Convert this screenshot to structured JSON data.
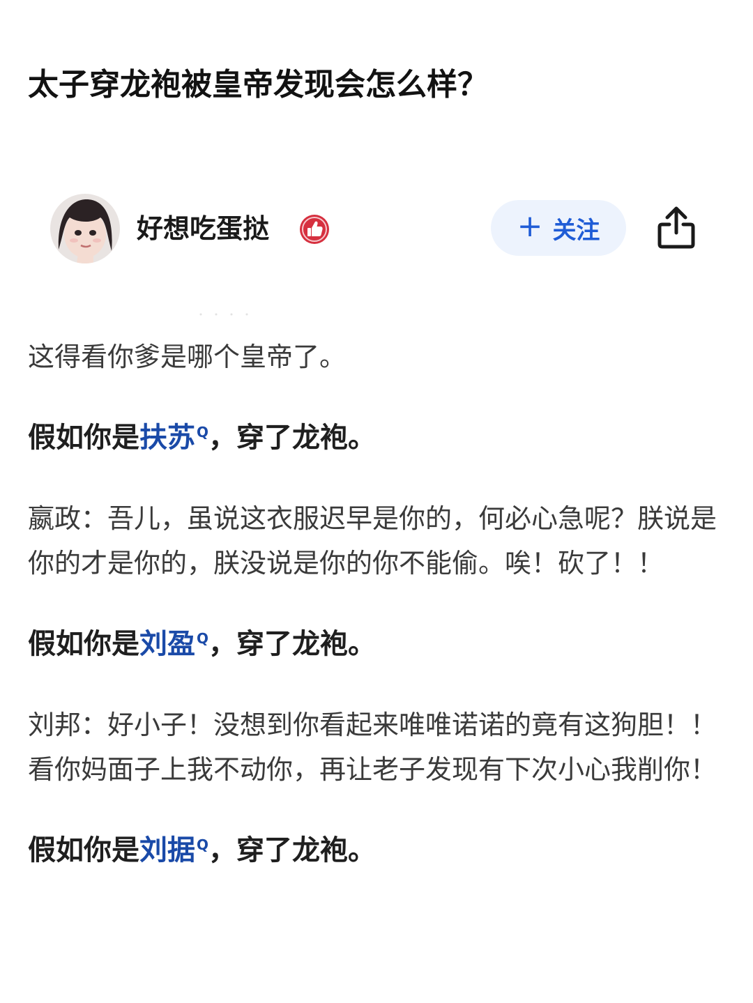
{
  "question": {
    "title": "太子穿龙袍被皇帝发现会怎么样？"
  },
  "author": {
    "name": "好想吃蛋挞",
    "avatar_icon": "avatar-photo",
    "badge_icon": "thumbs-up-badge-icon",
    "follow_label": "关注",
    "follow_plus": "+",
    "share_icon": "share-icon"
  },
  "answer": {
    "intro": "这得看你爹是哪个皇帝了。",
    "sections": [
      {
        "prefix": "假如你是",
        "link": "扶苏",
        "suffix": "，穿了龙袍。",
        "response": "嬴政：吾儿，虽说这衣服迟早是你的，何必心急呢？朕说是你的才是你的，朕没说是你的你不能偷。唉！砍了！！"
      },
      {
        "prefix": "假如你是",
        "link": "刘盈",
        "suffix": "，穿了龙袍。",
        "response": "刘邦：好小子！没想到你看起来唯唯诺诺的竟有这狗胆！！看你妈面子上我不动你，再让老子发现有下次小心我削你！"
      },
      {
        "prefix": "假如你是",
        "link": "刘据",
        "suffix": "，穿了龙袍。"
      }
    ]
  },
  "colors": {
    "link": "#1a4aa8",
    "follow_text": "#1f5cd6",
    "follow_bg": "#edf3fd",
    "badge": "#d6303f"
  }
}
